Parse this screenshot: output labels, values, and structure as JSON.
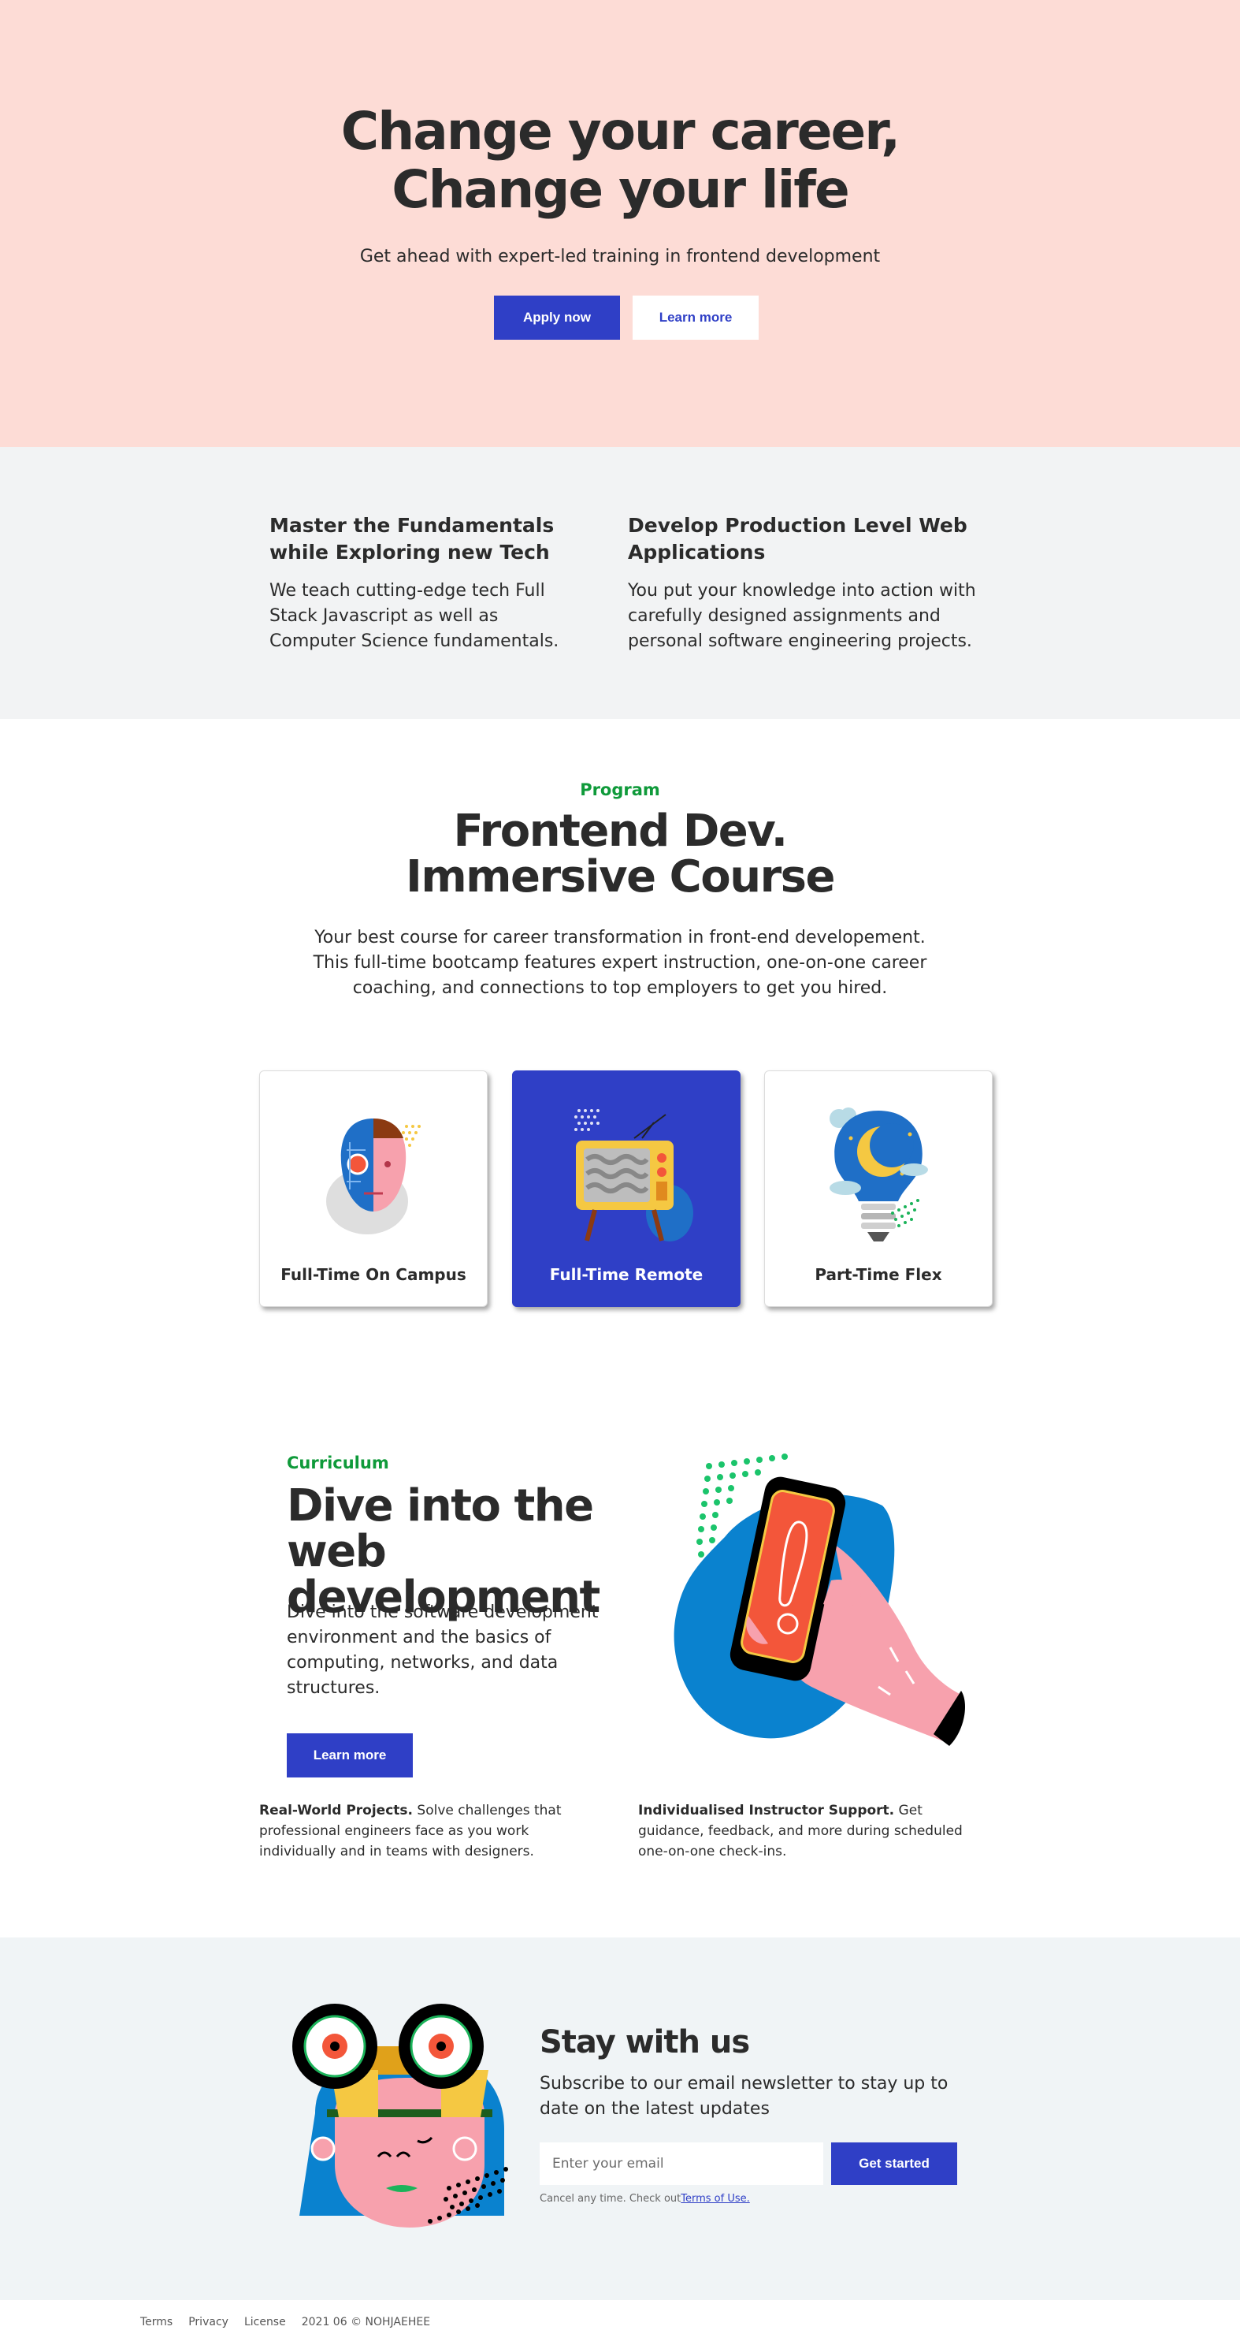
{
  "hero": {
    "title_line1": "Change your career,",
    "title_line2": "Change your life",
    "subtitle": "Get ahead with expert-led training in frontend development",
    "apply_label": "Apply now",
    "learn_label": "Learn more"
  },
  "features": [
    {
      "title": "Master the Fundamentals while Exploring new Tech",
      "body": "We teach cutting-edge tech Full Stack Javascript as well as Computer Science fundamentals."
    },
    {
      "title": "Develop Production Level Web Applications",
      "body": "You put your knowledge into action with carefully designed assignments and personal software engineering projects."
    }
  ],
  "program": {
    "eyebrow": "Program",
    "title_line1": "Frontend Dev.",
    "title_line2": "Immersive Course",
    "description": "Your best course for career transformation in front-end developement. This full-time bootcamp features expert instruction, one-on-one career coaching, and connections to top employers to get you hired.",
    "cards": [
      {
        "label": "Full-Time On Campus",
        "icon": "robot-face-icon",
        "active": false
      },
      {
        "label": "Full-Time Remote",
        "icon": "retro-tv-icon",
        "active": true
      },
      {
        "label": "Part-Time Flex",
        "icon": "moon-lightbulb-icon",
        "active": false
      }
    ]
  },
  "curriculum": {
    "eyebrow": "Curriculum",
    "title": "Dive into the web development",
    "description": "Dive into the software development environment and the basics of computing, networks, and data structures.",
    "learn_label": "Learn more",
    "points": [
      {
        "title": "Real-World Projects.",
        "body": " Solve challenges that professional engineers face as you work individually and in teams with designers."
      },
      {
        "title": "Individualised Instructor Support.",
        "body": " Get guidance, feedback, and more during scheduled one-on-one check-ins."
      }
    ]
  },
  "newsletter": {
    "title": "Stay with us",
    "subtitle": "Subscribe to our email newsletter to stay up to date on the latest updates",
    "email_placeholder": "Enter your email",
    "button_label": "Get started",
    "fine_print": "Cancel any time. Check out",
    "terms_link": "Terms of Use."
  },
  "footer": {
    "links": [
      "Terms",
      "Privacy",
      "License"
    ],
    "copyright": "2021 06 © NOHJAEHEE"
  },
  "colors": {
    "hero_bg": "#fddcd6",
    "primary": "#2f3fc6",
    "accent_green": "#0f9a3a",
    "section_gray": "#f2f3f4",
    "newsletter_bg": "#f0f4f6"
  }
}
